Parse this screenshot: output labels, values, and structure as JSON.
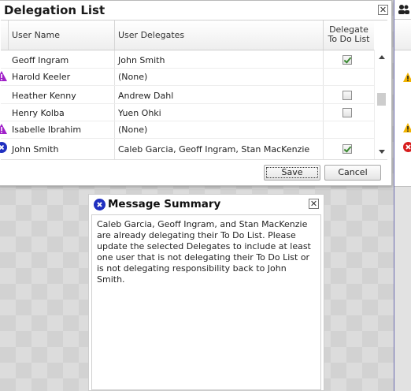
{
  "dialog": {
    "title": "Delegation List",
    "close_glyph": "✕",
    "columns": {
      "user_name": "User Name",
      "user_delegates": "User Delegates",
      "delegate_todo_line1": "Delegate",
      "delegate_todo_line2": "To Do List"
    },
    "rows": [
      {
        "name": "Geoff Ingram",
        "delegates": "John Smith",
        "checkbox": "checked",
        "status": "none"
      },
      {
        "name": "Harold Keeler",
        "delegates": "(None)",
        "checkbox": "hidden",
        "status": "warning"
      },
      {
        "name": "Heather Kenny",
        "delegates": "Andrew Dahl",
        "checkbox": "unchecked",
        "status": "none"
      },
      {
        "name": "Henry Kolba",
        "delegates": "Yuen Ohki",
        "checkbox": "unchecked",
        "status": "none"
      },
      {
        "name": "Isabelle Ibrahim",
        "delegates": "(None)",
        "checkbox": "hidden",
        "status": "warning"
      },
      {
        "name": "John Smith",
        "delegates": "Caleb Garcia, Geoff Ingram, Stan MacKenzie",
        "checkbox": "checked",
        "status": "error"
      }
    ],
    "save_label": "Save",
    "cancel_label": "Cancel"
  },
  "message_summary": {
    "title": "Message Summary",
    "close_glyph": "✕",
    "body": "Caleb Garcia, Geoff Ingram, and Stan MacKenzie are already delegating their To Do List. Please update the selected Delegates to include at least one user that is not delegating their To Do List or is not delegating responsibility back to John Smith."
  },
  "icons": {
    "warning": "warning-icon",
    "error": "error-icon",
    "users": "users-icon"
  },
  "colors": {
    "warning_purple": "#a020c8",
    "error_blue": "#2030c0",
    "warning_yellow": "#f2b400",
    "error_red": "#d81e1e",
    "check_green": "#3a8a30"
  }
}
